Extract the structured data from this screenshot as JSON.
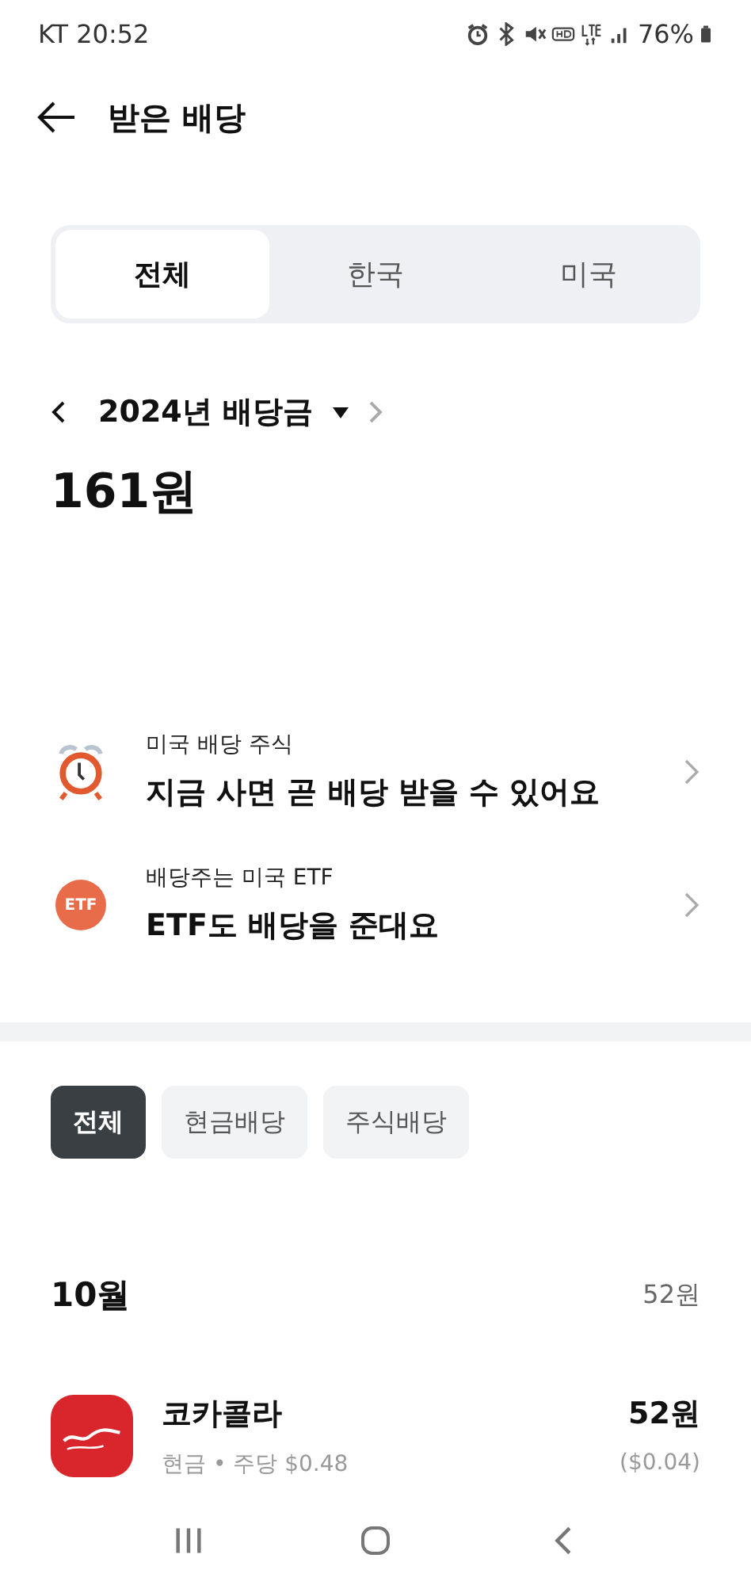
{
  "status_bar": {
    "carrier_time": "KT 20:52",
    "battery": "76%"
  },
  "header": {
    "title": "받은 배당"
  },
  "region_tabs": [
    {
      "label": "전체",
      "selected": true
    },
    {
      "label": "한국",
      "selected": false
    },
    {
      "label": "미국",
      "selected": false
    }
  ],
  "period": {
    "label": "2024년 배당금",
    "total": "161원"
  },
  "promos": [
    {
      "kind": "clock",
      "caption": "미국 배당 주식",
      "title": "지금 사면 곧 배당 받을 수 있어요"
    },
    {
      "kind": "etf",
      "badge": "ETF",
      "caption": "배당주는 미국 ETF",
      "title": "ETF도 배당을 준대요"
    }
  ],
  "type_chips": [
    {
      "label": "전체",
      "selected": true
    },
    {
      "label": "현금배당",
      "selected": false
    },
    {
      "label": "주식배당",
      "selected": false
    }
  ],
  "months": [
    {
      "month": "10월",
      "total": "52원",
      "items": [
        {
          "name": "코카콜라",
          "amount": "52원",
          "detail": "현금 • 주당 $0.48",
          "usd": "($0.04)"
        }
      ]
    }
  ]
}
